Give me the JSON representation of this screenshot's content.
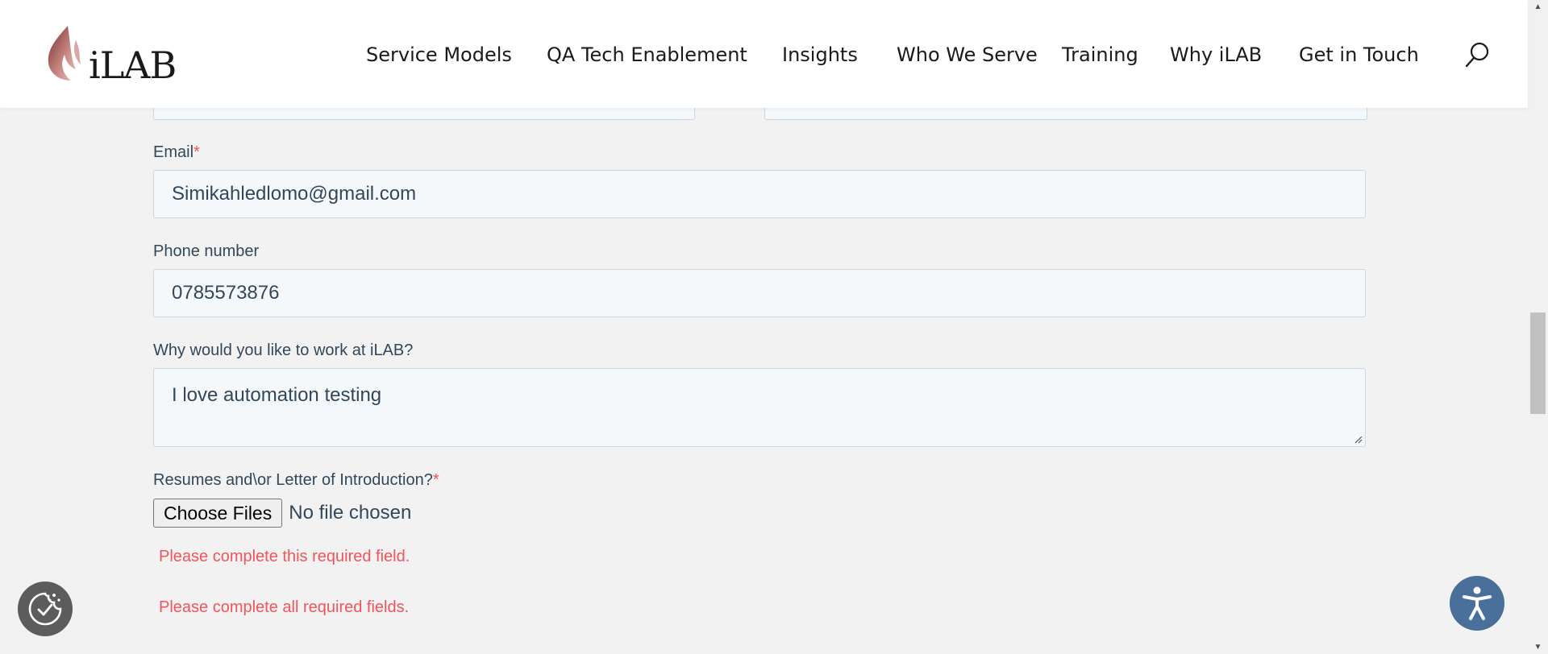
{
  "header": {
    "logo_text": "iLAB",
    "nav": [
      {
        "label": "Service Models"
      },
      {
        "label": "QA Tech Enablement"
      },
      {
        "label": "Insights"
      },
      {
        "label": "Who We Serve"
      },
      {
        "label": "Training"
      },
      {
        "label": "Why iLAB"
      },
      {
        "label": "Get in Touch"
      }
    ],
    "search_icon": "search-icon"
  },
  "form": {
    "email": {
      "label": "Email",
      "required_mark": "*",
      "value": "Simikahledlomo@gmail.com"
    },
    "phone": {
      "label": "Phone number",
      "value": "0785573876"
    },
    "why": {
      "label": "Why would you like to work at iLAB?",
      "value": "I love automation testing"
    },
    "resume": {
      "label": "Resumes and\\or Letter of Introduction?",
      "required_mark": "*",
      "button_label": "Choose Files",
      "status": "No file chosen"
    },
    "errors": {
      "field_error": "Please complete this required field.",
      "form_error": "Please complete all required fields."
    }
  },
  "widgets": {
    "cookie_icon": "cookie-consent-icon",
    "accessibility_icon": "accessibility-icon"
  },
  "colors": {
    "error": "#f2545b",
    "field_bg": "#f4f8fb",
    "field_border": "#cbd6e2",
    "accessibility": "#48709a",
    "cookie": "#5c5c5c"
  }
}
